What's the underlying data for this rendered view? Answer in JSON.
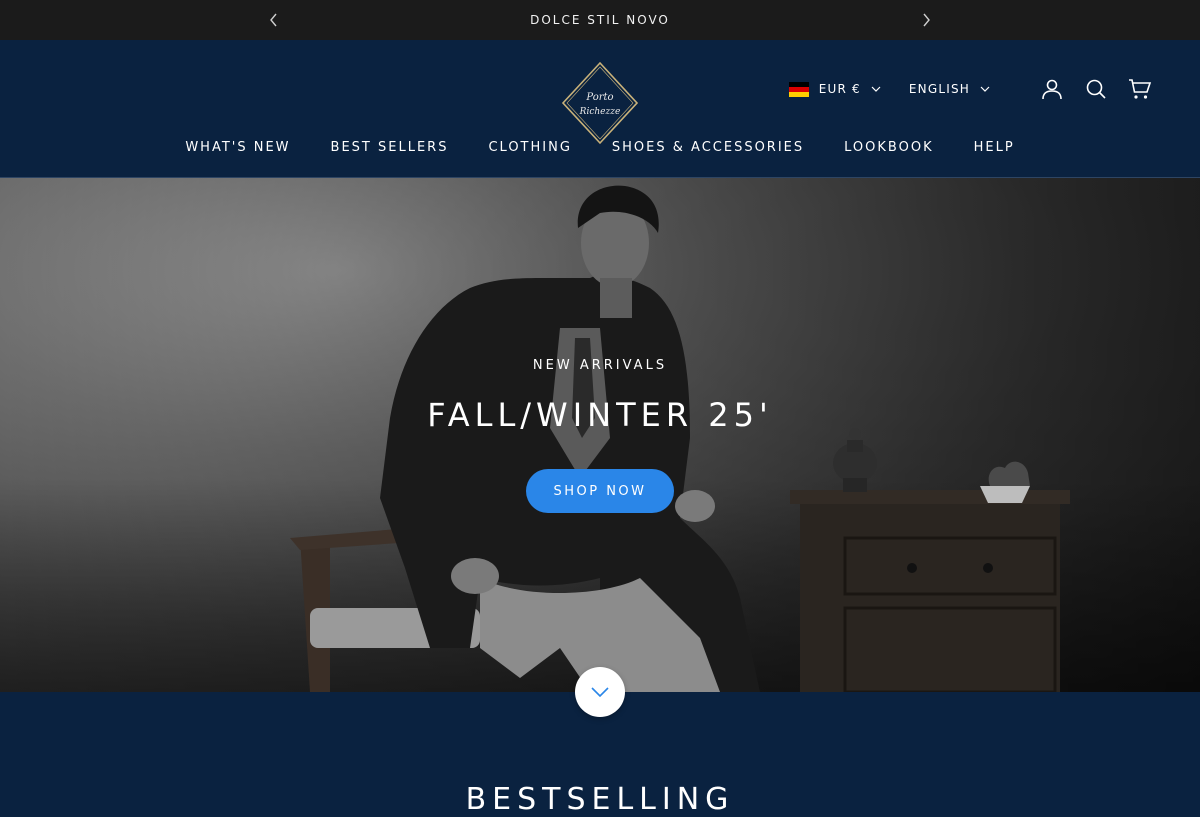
{
  "announcement": {
    "message": "DOLCE STIL NOVO",
    "prev_icon": "chevron-left-icon",
    "next_icon": "chevron-right-icon"
  },
  "header": {
    "logo_text_line1": "Porto",
    "logo_text_line2": "Richezze",
    "currency": "EUR €",
    "language": "ENGLISH",
    "flag_colors": [
      "#000000",
      "#dd0000",
      "#ffce00"
    ],
    "icons": [
      "account-icon",
      "search-icon",
      "cart-icon"
    ]
  },
  "nav": {
    "items": [
      "WHAT'S NEW",
      "BEST SELLERS",
      "CLOTHING",
      "SHOES & ACCESSORIES",
      "LOOKBOOK",
      "HELP"
    ]
  },
  "hero": {
    "subtitle": "NEW ARRIVALS",
    "title": "FALL/WINTER 25'",
    "cta": "SHOP NOW"
  },
  "section": {
    "title": "BESTSELLING"
  },
  "colors": {
    "brand_navy": "#0a2240",
    "announcement_bg": "#1b1b1b",
    "cta_blue": "#2a86e8"
  }
}
